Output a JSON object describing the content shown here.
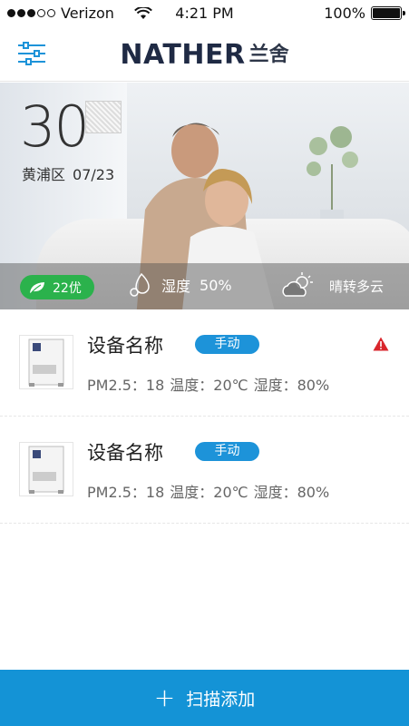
{
  "status_bar": {
    "carrier": "Verizon",
    "time": "4:21 PM",
    "battery": "100%"
  },
  "header": {
    "brand_en": "NATHER",
    "brand_cn": "兰舍"
  },
  "hero": {
    "temperature": "30°",
    "district": "黄浦区",
    "date": "07/23",
    "aqi": "22优",
    "humidity_label": "湿度",
    "humidity_value": "50%",
    "weather": "晴转多云"
  },
  "devices": [
    {
      "name": "设备名称",
      "mode": "手动",
      "pm": "PM2.5：18",
      "temperature": "温度：20℃",
      "humidity": "湿度：80%",
      "alert": true
    },
    {
      "name": "设备名称",
      "mode": "手动",
      "pm": "PM2.5：18",
      "temperature": "温度：20℃",
      "humidity": "湿度：80%",
      "alert": false
    }
  ],
  "footer": {
    "scan_add": "扫描添加"
  },
  "colors": {
    "accent": "#1493d6",
    "aqi_good": "#2bb24c",
    "alert": "#d9262c"
  }
}
